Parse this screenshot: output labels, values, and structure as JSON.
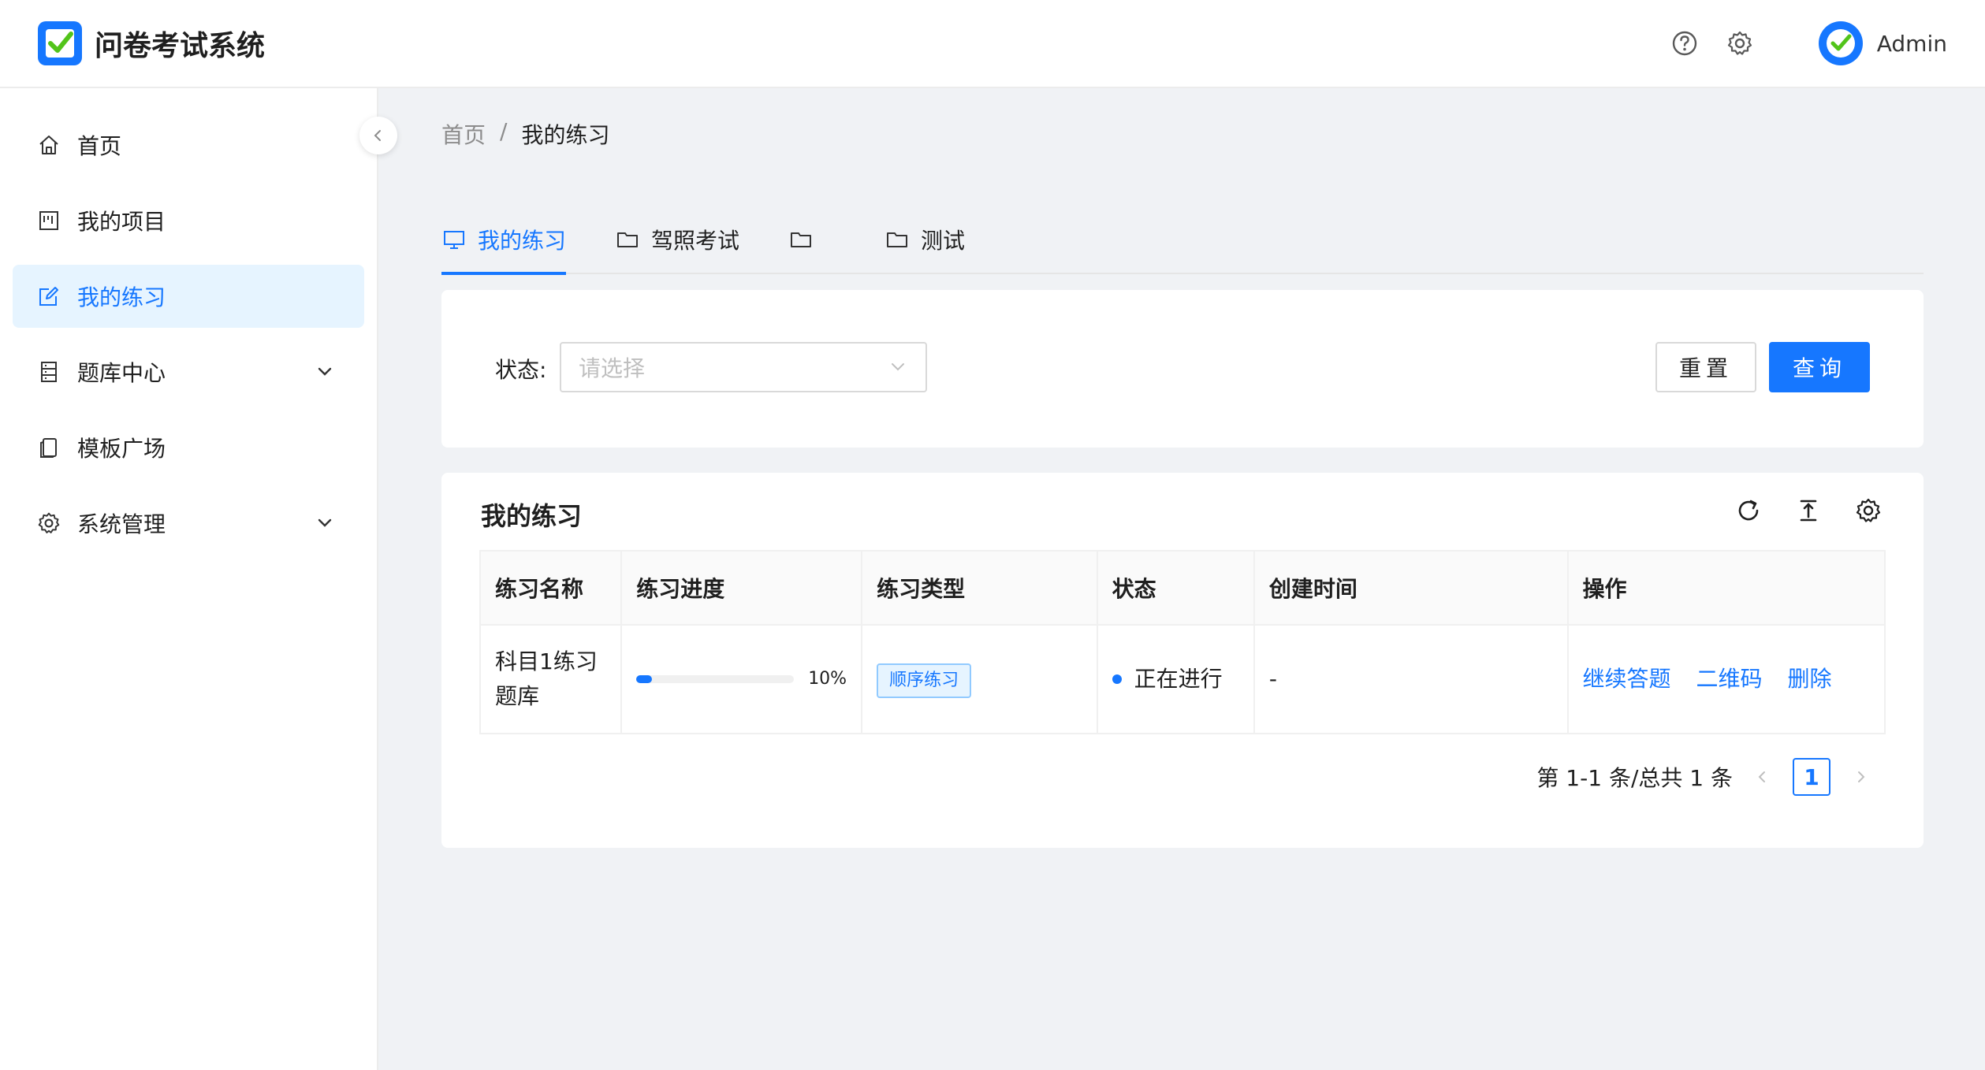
{
  "app": {
    "title": "问卷考试系统"
  },
  "header": {
    "username": "Admin"
  },
  "sidebar": {
    "items": [
      {
        "label": "首页",
        "icon": "home-icon"
      },
      {
        "label": "我的项目",
        "icon": "project-icon"
      },
      {
        "label": "我的练习",
        "icon": "edit-icon",
        "active": true
      },
      {
        "label": "题库中心",
        "icon": "database-icon",
        "expandable": true
      },
      {
        "label": "模板广场",
        "icon": "template-icon"
      },
      {
        "label": "系统管理",
        "icon": "gear-icon",
        "expandable": true
      }
    ]
  },
  "breadcrumb": {
    "home": "首页",
    "separator": "/",
    "current": "我的练习"
  },
  "tabs": [
    {
      "label": "我的练习",
      "icon": "monitor-icon",
      "active": true
    },
    {
      "label": "驾照考试",
      "icon": "folder-icon"
    },
    {
      "label": "",
      "icon": "folder-icon"
    },
    {
      "label": "测试",
      "icon": "folder-icon"
    }
  ],
  "filter": {
    "status_label": "状态:",
    "status_placeholder": "请选择",
    "reset_label": "重置",
    "query_label": "查询"
  },
  "table": {
    "title": "我的练习",
    "columns": [
      "练习名称",
      "练习进度",
      "练习类型",
      "状态",
      "创建时间",
      "操作"
    ],
    "rows": [
      {
        "name": "科目1练习题库",
        "progress": 10,
        "progress_text": "10%",
        "type": "顺序练习",
        "status": "正在进行",
        "created": "-",
        "actions": [
          "继续答题",
          "二维码",
          "删除"
        ]
      }
    ]
  },
  "pagination": {
    "summary": "第 1-1 条/总共 1 条",
    "current_page": "1"
  },
  "colors": {
    "primary": "#1677ff",
    "active_bg": "#e6f4ff",
    "logo_check": "#52c41a"
  }
}
